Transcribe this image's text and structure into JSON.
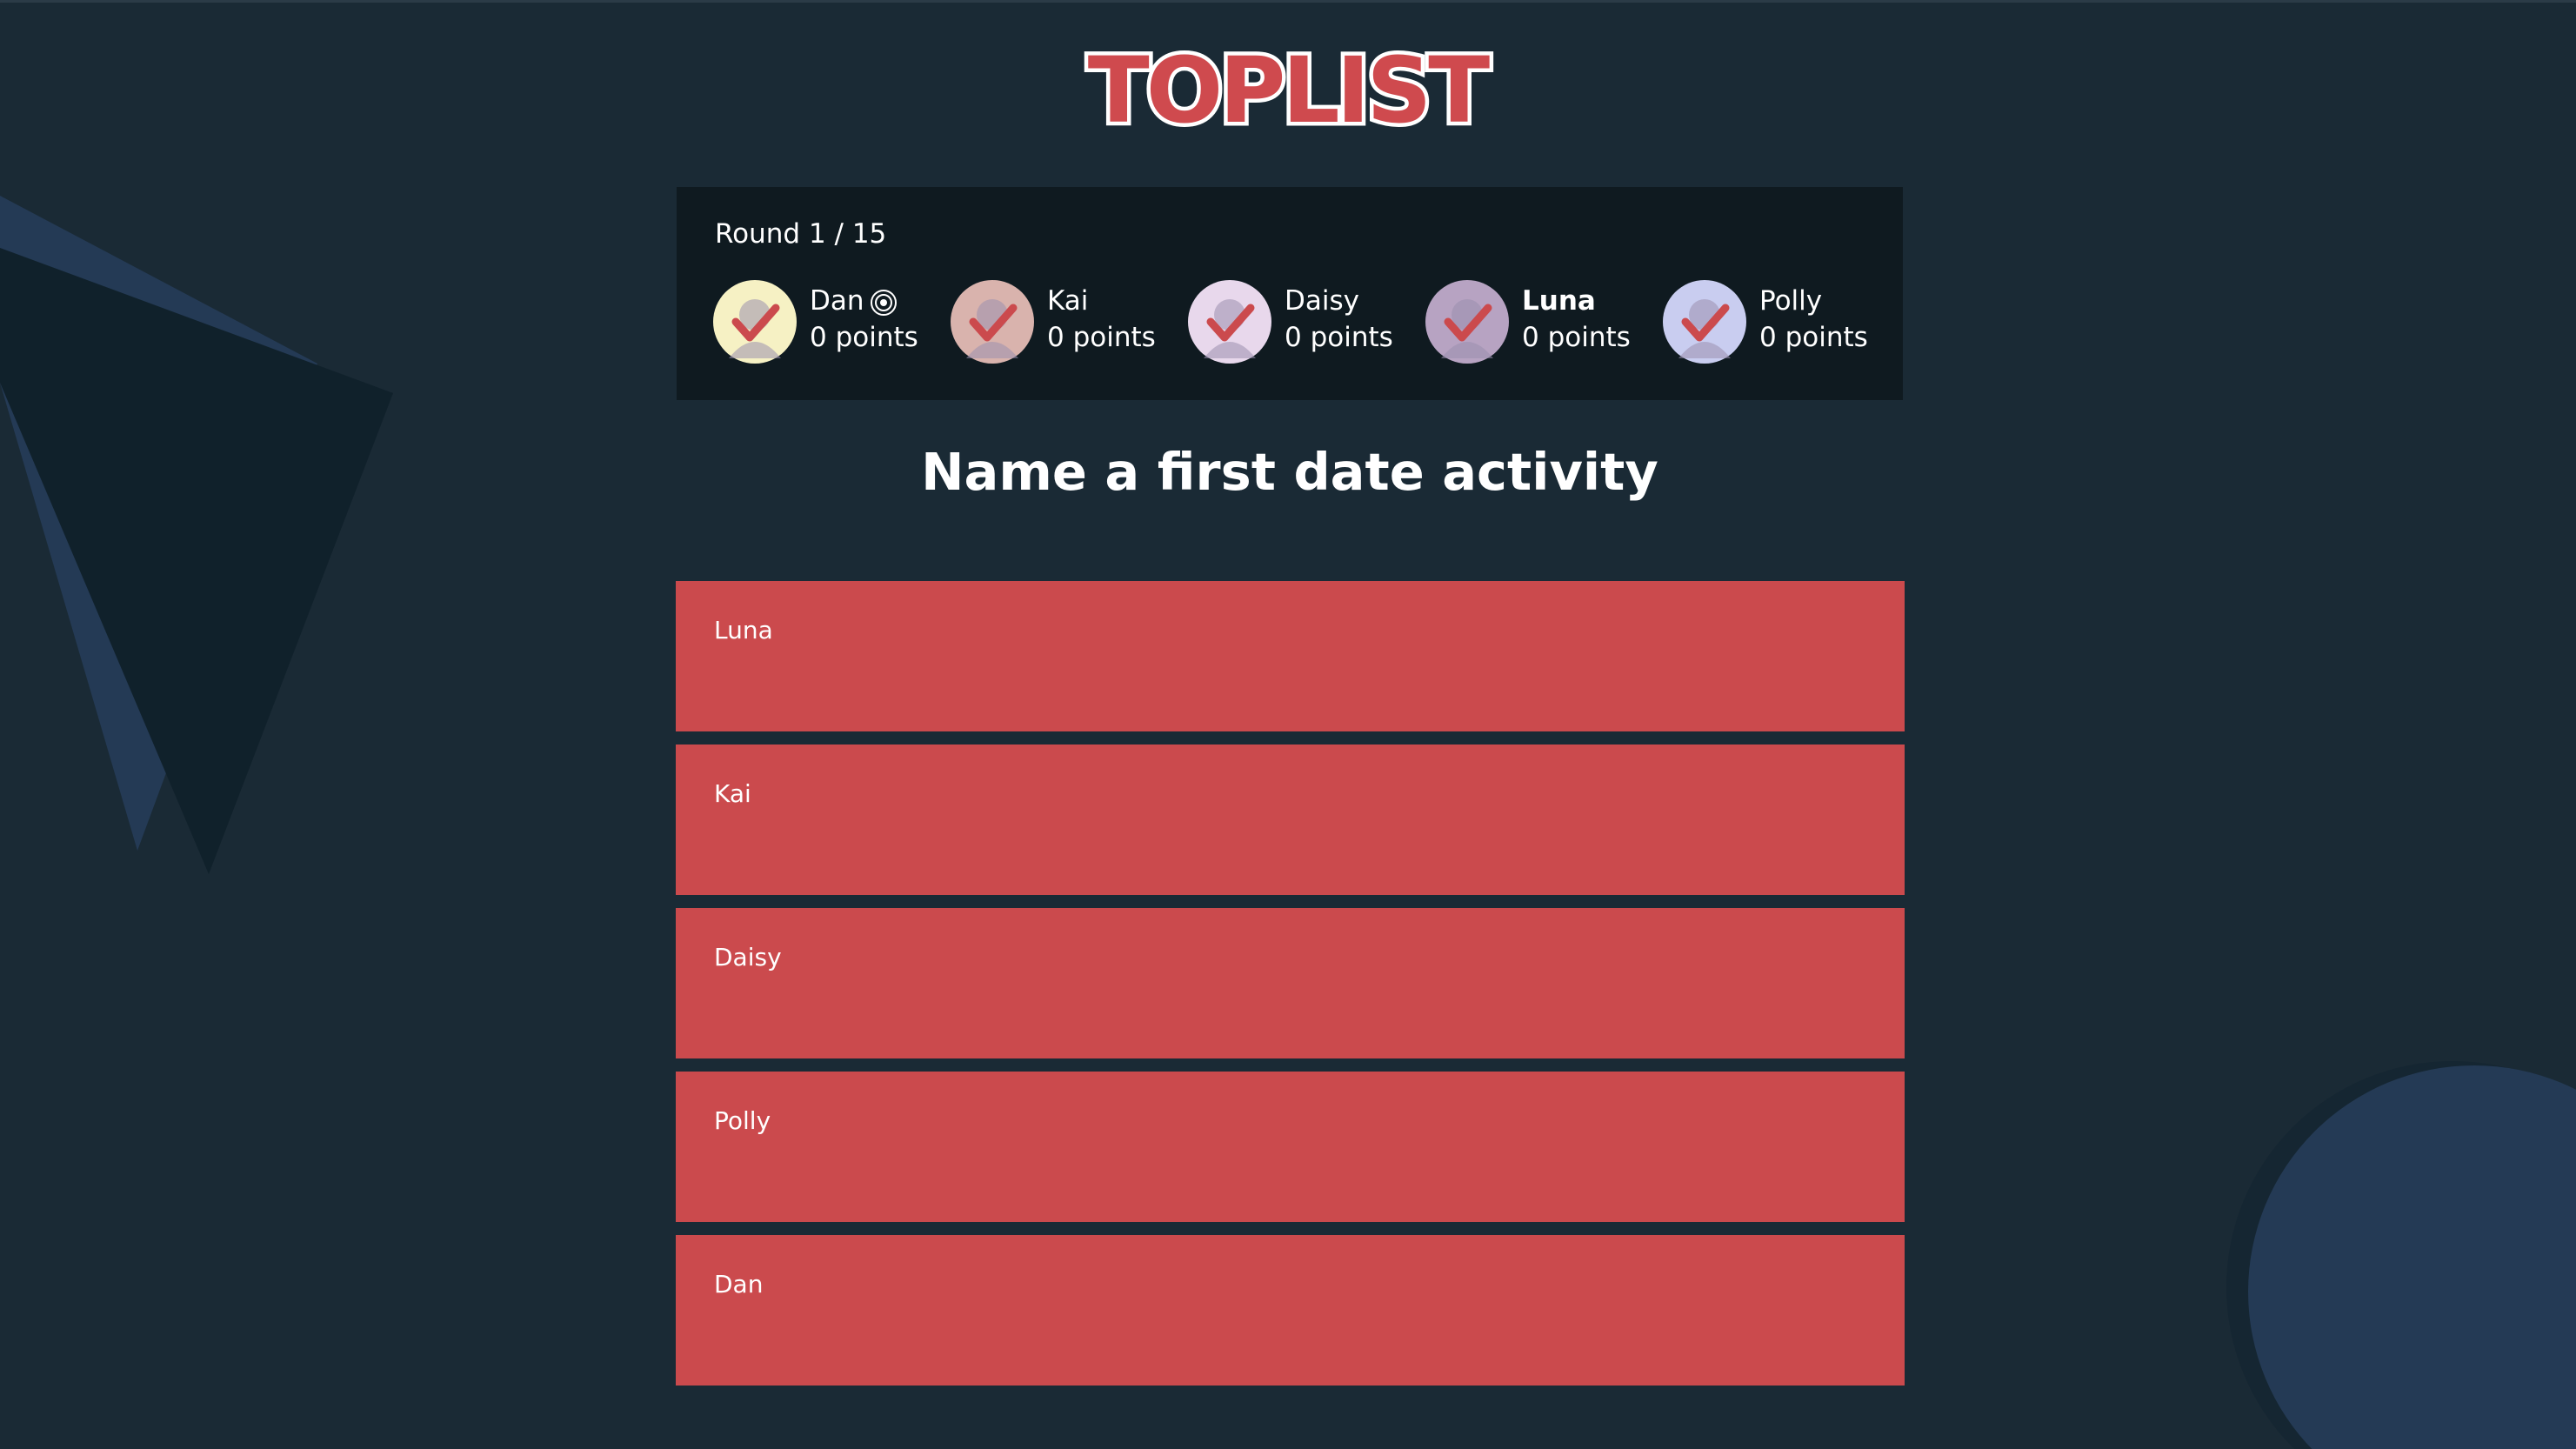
{
  "app": {
    "logo_text": "TOPLIST"
  },
  "colors": {
    "background": "#1a2a35",
    "panel": "#0f1a20",
    "accent_red": "#cb4a4d",
    "shape_blue": "#243a55"
  },
  "scoreboard": {
    "round_label": "Round 1 / 15",
    "players": [
      {
        "name": "Dan",
        "points": "0 points",
        "host": true,
        "active": false,
        "avatar_color": "#f6f1c4",
        "check": "checkmark-icon"
      },
      {
        "name": "Kai",
        "points": "0 points",
        "host": false,
        "active": false,
        "avatar_color": "#d9b3ad",
        "check": "checkmark-icon"
      },
      {
        "name": "Daisy",
        "points": "0 points",
        "host": false,
        "active": false,
        "avatar_color": "#e8d8ec",
        "check": "checkmark-icon"
      },
      {
        "name": "Luna",
        "points": "0 points",
        "host": false,
        "active": true,
        "avatar_color": "#b7a3c2",
        "check": "checkmark-icon"
      },
      {
        "name": "Polly",
        "points": "0 points",
        "host": false,
        "active": false,
        "avatar_color": "#c9cdf0",
        "check": "checkmark-icon"
      }
    ]
  },
  "question": {
    "text": "Name a first date activity"
  },
  "answers": [
    {
      "player": "Luna"
    },
    {
      "player": "Kai"
    },
    {
      "player": "Daisy"
    },
    {
      "player": "Polly"
    },
    {
      "player": "Dan"
    }
  ]
}
